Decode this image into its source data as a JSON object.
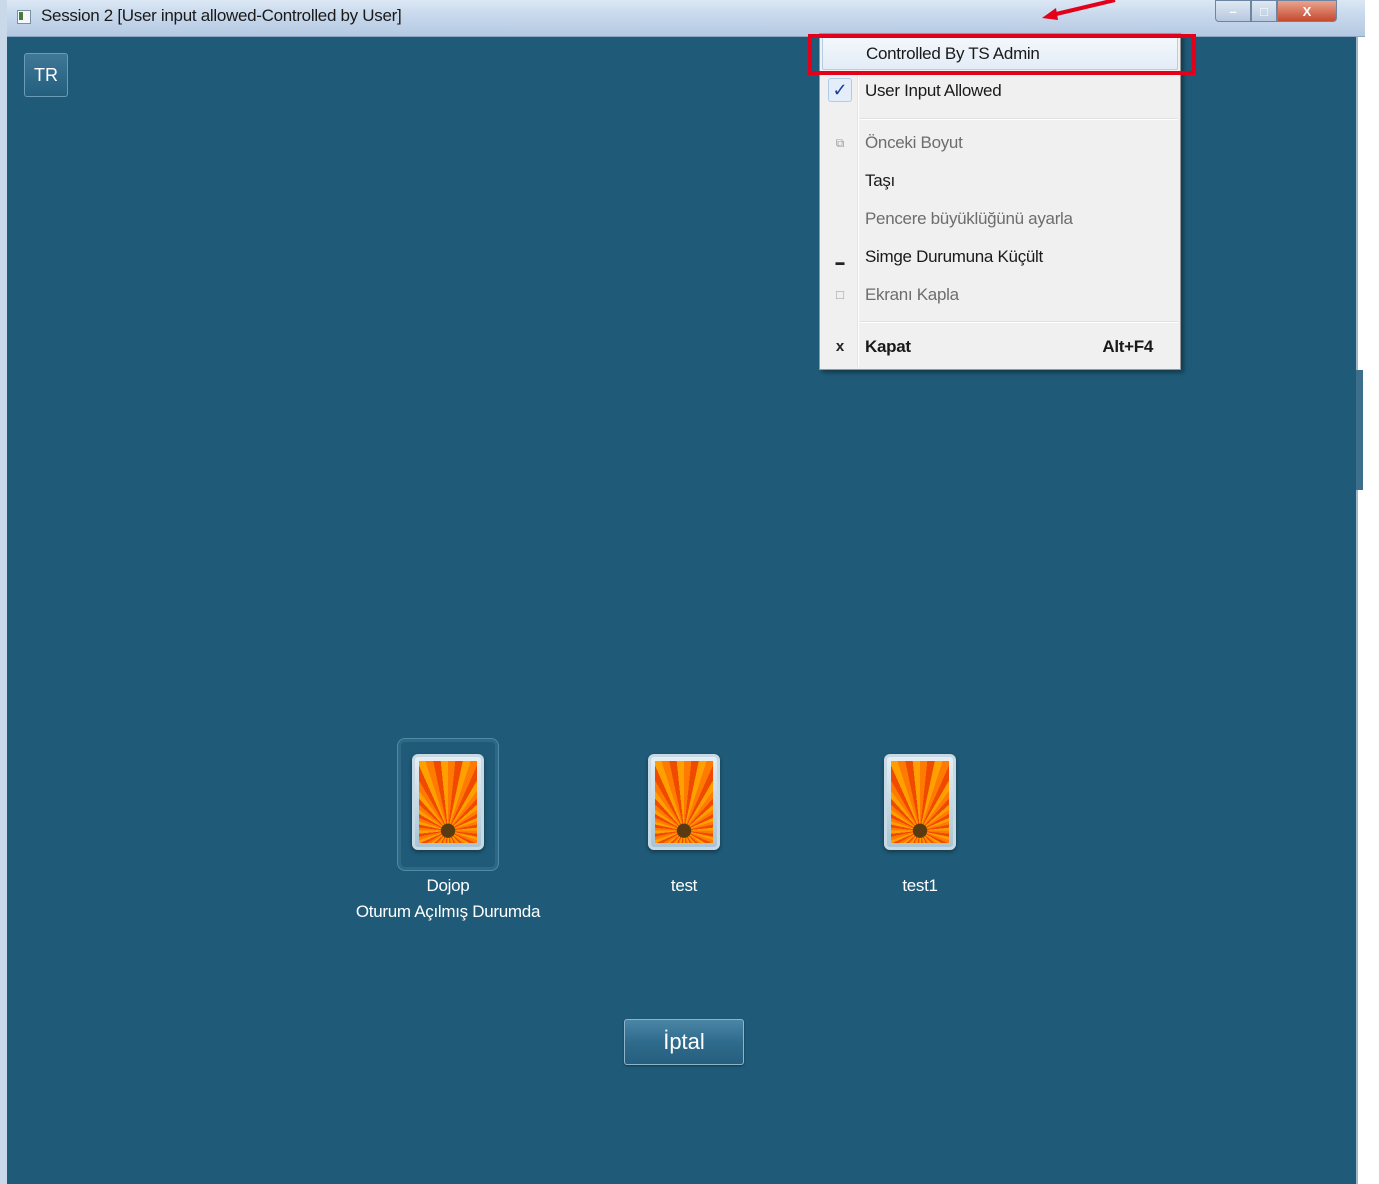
{
  "window": {
    "title": "Session 2 [User input allowed-Controlled by User]",
    "controls": {
      "minimize": "–",
      "maximize": "□",
      "close": "X"
    }
  },
  "language_button": "TR",
  "system_menu": {
    "items": [
      {
        "label": "Controlled By TS Admin",
        "icon": "",
        "enabled": true,
        "highlighted": true
      },
      {
        "label": "User Input Allowed",
        "icon": "check-icon",
        "checked": true,
        "enabled": true
      },
      {
        "label": "Önceki Boyut",
        "icon": "restore-icon",
        "enabled": false
      },
      {
        "label": "Taşı",
        "icon": "",
        "enabled": true
      },
      {
        "label": "Pencere büyüklüğünü ayarla",
        "icon": "",
        "enabled": false
      },
      {
        "label": "Simge Durumuna Küçült",
        "icon": "minimize-icon",
        "enabled": true
      },
      {
        "label": "Ekranı Kapla",
        "icon": "maximize-icon",
        "enabled": false
      },
      {
        "label": "Kapat",
        "icon": "close-icon",
        "shortcut": "Alt+F4",
        "enabled": true,
        "bold": true
      }
    ],
    "icons": {
      "check": "✓",
      "restore": "⧉",
      "minimize": "▬",
      "maximize": "□",
      "close": "x"
    }
  },
  "users": [
    {
      "name": "Dojop",
      "status": "Oturum Açılmış Durumda",
      "selected": true
    },
    {
      "name": "test",
      "status": ""
    },
    {
      "name": "test1",
      "status": ""
    }
  ],
  "cancel_button": "İptal",
  "colors": {
    "background": "#1f5b78",
    "highlight_box": "#e3001b",
    "menu_background": "#f0f0f0"
  }
}
